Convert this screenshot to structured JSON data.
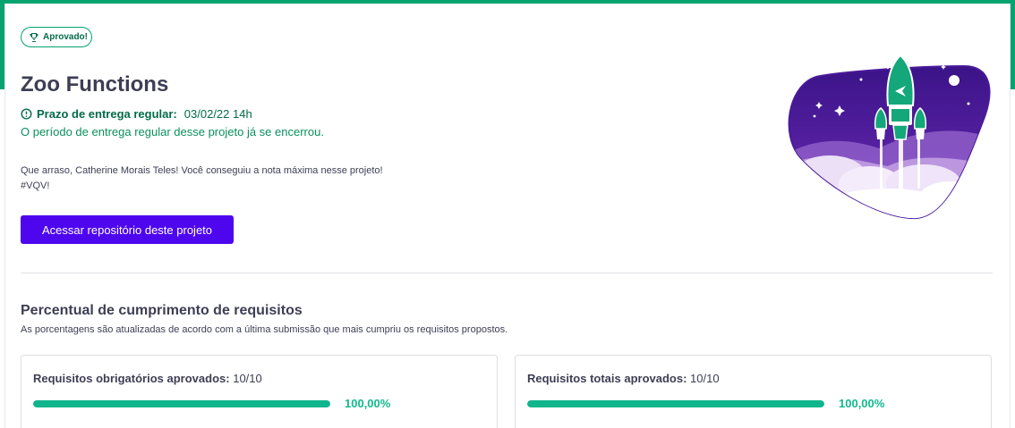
{
  "badge": {
    "label": "Aprovado!",
    "icon": "trophy-icon"
  },
  "project": {
    "title": "Zoo Functions",
    "deadline_label": "Prazo de entrega regular:",
    "deadline_value": "03/02/22 14h",
    "closed_note": "O período de entrega regular desse projeto já se encerrou.",
    "congrats_line1": "Que arraso, Catherine Morais Teles! Você conseguiu a nota máxima nesse projeto!",
    "congrats_line2": "#VQV!",
    "repo_button": "Acessar repositório deste projeto"
  },
  "requirements": {
    "title": "Percentual de cumprimento de requisitos",
    "subtitle": "As porcentagens são atualizadas de acordo com a última submissão que mais cumpriu os requisitos propostos.",
    "cards": [
      {
        "label": "Requisitos obrigatórios aprovados:",
        "value": "10/10",
        "percent_text": "100,00%",
        "progress": 1.0
      },
      {
        "label": "Requisitos totais aprovados:",
        "value": "10/10",
        "percent_text": "100,00%",
        "progress": 1.0
      }
    ]
  },
  "colors": {
    "accent_green": "#05a36f",
    "button_purple": "#4e06ee",
    "progress_green": "#0fb58c",
    "illustration_purple": "#4a1a99"
  }
}
